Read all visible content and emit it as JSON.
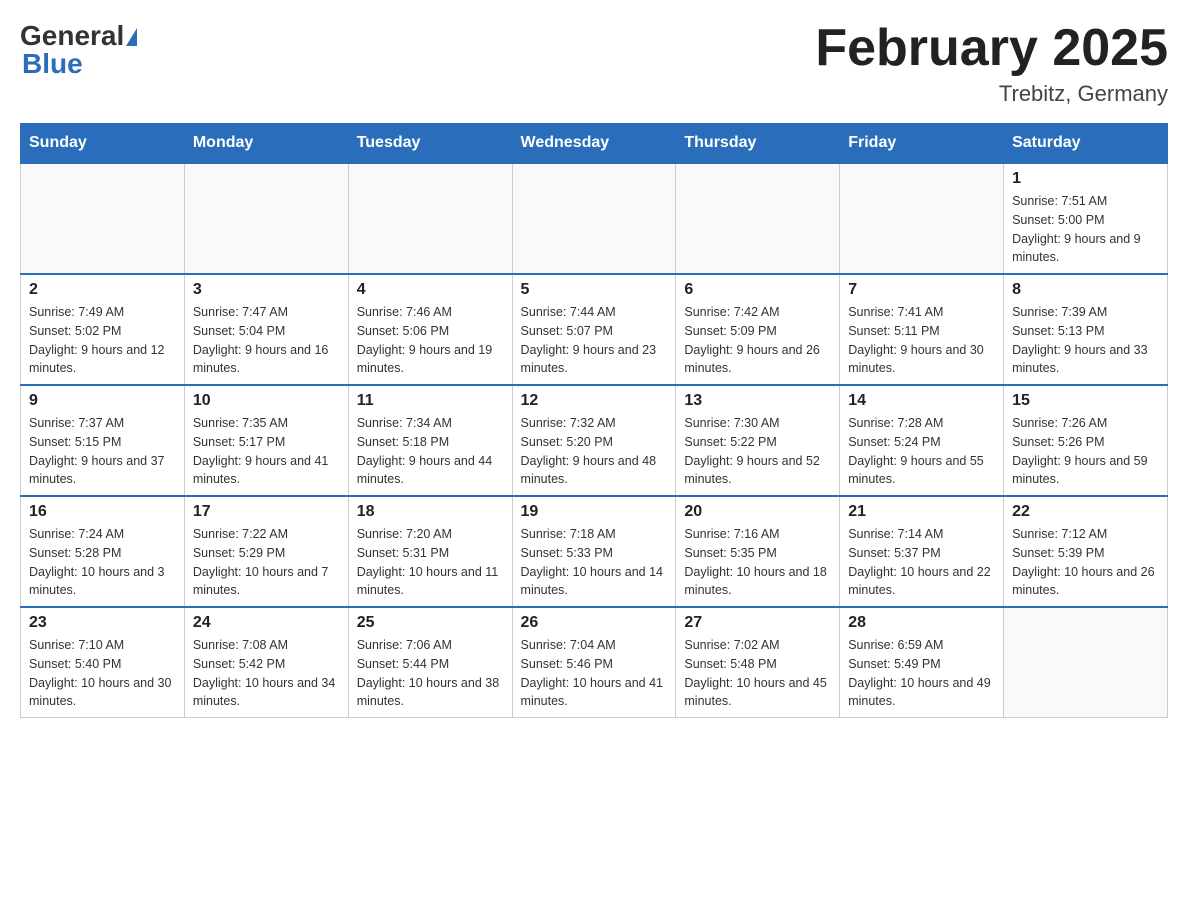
{
  "header": {
    "logo_general": "General",
    "logo_blue": "Blue",
    "title": "February 2025",
    "subtitle": "Trebitz, Germany"
  },
  "days_of_week": [
    "Sunday",
    "Monday",
    "Tuesday",
    "Wednesday",
    "Thursday",
    "Friday",
    "Saturday"
  ],
  "weeks": [
    [
      {
        "day": "",
        "info": ""
      },
      {
        "day": "",
        "info": ""
      },
      {
        "day": "",
        "info": ""
      },
      {
        "day": "",
        "info": ""
      },
      {
        "day": "",
        "info": ""
      },
      {
        "day": "",
        "info": ""
      },
      {
        "day": "1",
        "info": "Sunrise: 7:51 AM\nSunset: 5:00 PM\nDaylight: 9 hours and 9 minutes."
      }
    ],
    [
      {
        "day": "2",
        "info": "Sunrise: 7:49 AM\nSunset: 5:02 PM\nDaylight: 9 hours and 12 minutes."
      },
      {
        "day": "3",
        "info": "Sunrise: 7:47 AM\nSunset: 5:04 PM\nDaylight: 9 hours and 16 minutes."
      },
      {
        "day": "4",
        "info": "Sunrise: 7:46 AM\nSunset: 5:06 PM\nDaylight: 9 hours and 19 minutes."
      },
      {
        "day": "5",
        "info": "Sunrise: 7:44 AM\nSunset: 5:07 PM\nDaylight: 9 hours and 23 minutes."
      },
      {
        "day": "6",
        "info": "Sunrise: 7:42 AM\nSunset: 5:09 PM\nDaylight: 9 hours and 26 minutes."
      },
      {
        "day": "7",
        "info": "Sunrise: 7:41 AM\nSunset: 5:11 PM\nDaylight: 9 hours and 30 minutes."
      },
      {
        "day": "8",
        "info": "Sunrise: 7:39 AM\nSunset: 5:13 PM\nDaylight: 9 hours and 33 minutes."
      }
    ],
    [
      {
        "day": "9",
        "info": "Sunrise: 7:37 AM\nSunset: 5:15 PM\nDaylight: 9 hours and 37 minutes."
      },
      {
        "day": "10",
        "info": "Sunrise: 7:35 AM\nSunset: 5:17 PM\nDaylight: 9 hours and 41 minutes."
      },
      {
        "day": "11",
        "info": "Sunrise: 7:34 AM\nSunset: 5:18 PM\nDaylight: 9 hours and 44 minutes."
      },
      {
        "day": "12",
        "info": "Sunrise: 7:32 AM\nSunset: 5:20 PM\nDaylight: 9 hours and 48 minutes."
      },
      {
        "day": "13",
        "info": "Sunrise: 7:30 AM\nSunset: 5:22 PM\nDaylight: 9 hours and 52 minutes."
      },
      {
        "day": "14",
        "info": "Sunrise: 7:28 AM\nSunset: 5:24 PM\nDaylight: 9 hours and 55 minutes."
      },
      {
        "day": "15",
        "info": "Sunrise: 7:26 AM\nSunset: 5:26 PM\nDaylight: 9 hours and 59 minutes."
      }
    ],
    [
      {
        "day": "16",
        "info": "Sunrise: 7:24 AM\nSunset: 5:28 PM\nDaylight: 10 hours and 3 minutes."
      },
      {
        "day": "17",
        "info": "Sunrise: 7:22 AM\nSunset: 5:29 PM\nDaylight: 10 hours and 7 minutes."
      },
      {
        "day": "18",
        "info": "Sunrise: 7:20 AM\nSunset: 5:31 PM\nDaylight: 10 hours and 11 minutes."
      },
      {
        "day": "19",
        "info": "Sunrise: 7:18 AM\nSunset: 5:33 PM\nDaylight: 10 hours and 14 minutes."
      },
      {
        "day": "20",
        "info": "Sunrise: 7:16 AM\nSunset: 5:35 PM\nDaylight: 10 hours and 18 minutes."
      },
      {
        "day": "21",
        "info": "Sunrise: 7:14 AM\nSunset: 5:37 PM\nDaylight: 10 hours and 22 minutes."
      },
      {
        "day": "22",
        "info": "Sunrise: 7:12 AM\nSunset: 5:39 PM\nDaylight: 10 hours and 26 minutes."
      }
    ],
    [
      {
        "day": "23",
        "info": "Sunrise: 7:10 AM\nSunset: 5:40 PM\nDaylight: 10 hours and 30 minutes."
      },
      {
        "day": "24",
        "info": "Sunrise: 7:08 AM\nSunset: 5:42 PM\nDaylight: 10 hours and 34 minutes."
      },
      {
        "day": "25",
        "info": "Sunrise: 7:06 AM\nSunset: 5:44 PM\nDaylight: 10 hours and 38 minutes."
      },
      {
        "day": "26",
        "info": "Sunrise: 7:04 AM\nSunset: 5:46 PM\nDaylight: 10 hours and 41 minutes."
      },
      {
        "day": "27",
        "info": "Sunrise: 7:02 AM\nSunset: 5:48 PM\nDaylight: 10 hours and 45 minutes."
      },
      {
        "day": "28",
        "info": "Sunrise: 6:59 AM\nSunset: 5:49 PM\nDaylight: 10 hours and 49 minutes."
      },
      {
        "day": "",
        "info": ""
      }
    ]
  ]
}
